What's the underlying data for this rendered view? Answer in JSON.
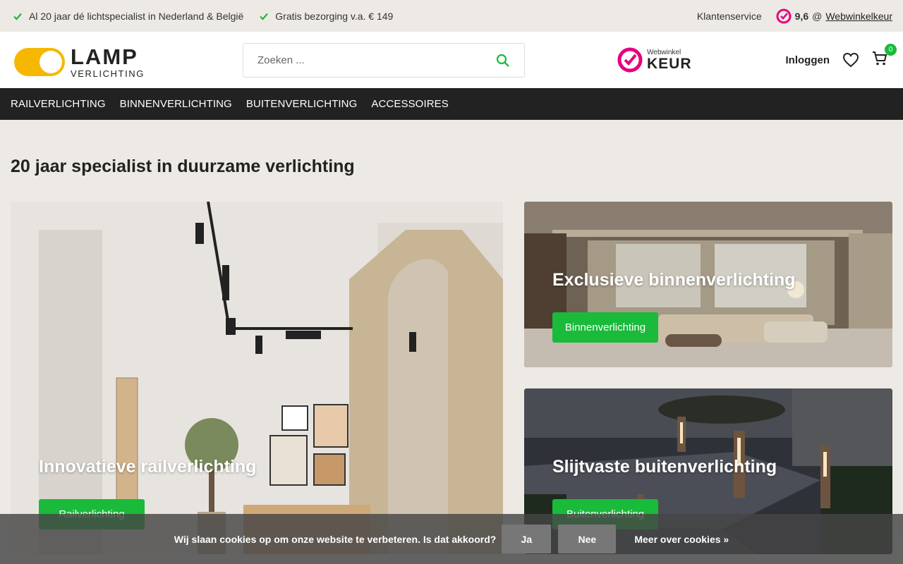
{
  "topbar": {
    "usps": [
      "Al 20 jaar dé lichtspecialist in Nederland & België",
      "Gratis bezorging v.a. € 149"
    ],
    "customer_service": "Klantenservice",
    "rating_score": "9,6",
    "rating_at": "@",
    "rating_link": "Webwinkelkeur"
  },
  "header": {
    "logo_word1": "LAMP",
    "logo_word2": "VERLICHTING",
    "search_placeholder": "Zoeken ...",
    "keur_small": "Webwinkel",
    "keur_big": "KEUR",
    "login": "Inloggen",
    "cart_count": "0"
  },
  "nav": {
    "items": [
      "RAILVERLICHTING",
      "BINNENVERLICHTING",
      "BUITENVERLICHTING",
      "ACCESSOIRES"
    ]
  },
  "main": {
    "heading": "20 jaar specialist in duurzame verlichting",
    "cards": [
      {
        "title": "Innovatieve railverlichting",
        "button": "Railverlichting"
      },
      {
        "title": "Exclusieve binnenverlichting",
        "button": "Binnenverlichting"
      },
      {
        "title": "Slijtvaste buitenverlichting",
        "button": "Buitenverlichting"
      }
    ]
  },
  "cookie": {
    "message": "Wij slaan cookies op om onze website te verbeteren. Is dat akkoord?",
    "yes": "Ja",
    "no": "Nee",
    "more": "Meer over cookies »"
  },
  "colors": {
    "accent_green": "#1aba3a",
    "logo_yellow": "#f6b700",
    "keur_pink": "#e6007e",
    "nav_bg": "#222222",
    "page_bg": "#edeae5"
  }
}
